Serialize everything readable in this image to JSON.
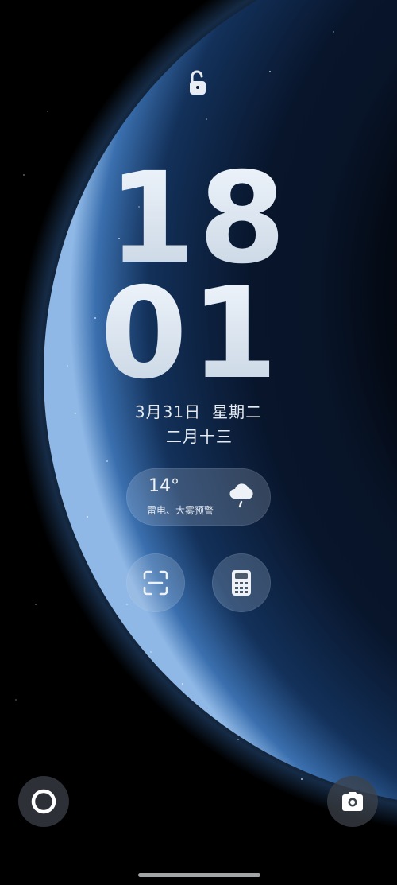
{
  "lockscreen": {
    "lock_icon": "unlocked-padlock-icon",
    "clock": {
      "hours": "18",
      "minutes": "01"
    },
    "date": {
      "month_day": "3月31日",
      "weekday": "星期二",
      "lunar": "二月十三"
    },
    "weather": {
      "temperature": "14°",
      "alert": "雷电、大雾预警",
      "icon": "cloud-rain-icon"
    },
    "shortcuts": [
      {
        "name": "scan",
        "icon": "scan-icon"
      },
      {
        "name": "calculator",
        "icon": "calculator-icon"
      }
    ],
    "bottom": {
      "left_icon": "circle-assistant-icon",
      "right_icon": "camera-icon"
    },
    "colors": {
      "background": "#000000",
      "planet_glow": "#3f7fd0",
      "widget_bg": "#c8d7e6",
      "text": "#e8edf3"
    }
  }
}
